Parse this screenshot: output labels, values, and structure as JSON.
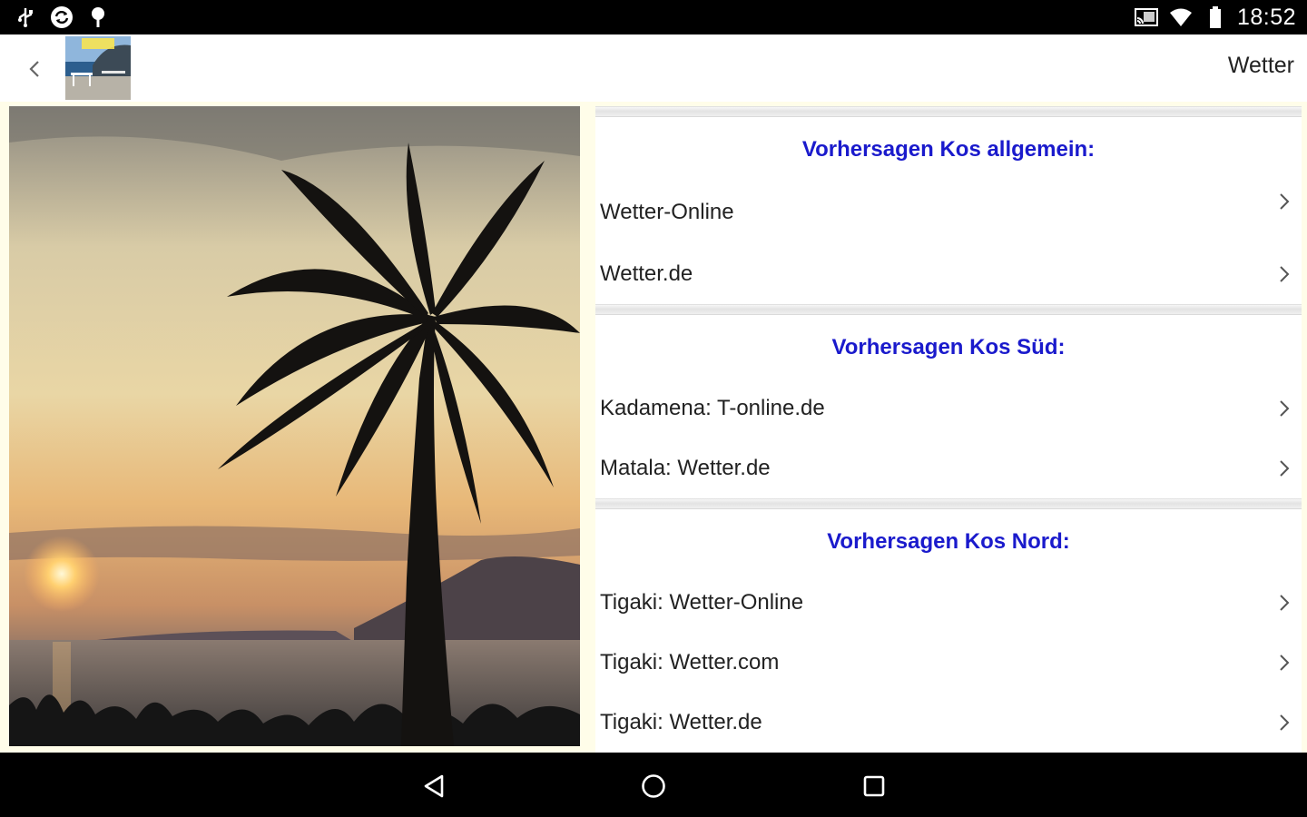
{
  "status_bar": {
    "time": "18:52",
    "icons": [
      "usb-icon",
      "sync-icon",
      "location-pin-icon",
      "cast-icon",
      "wifi-icon",
      "battery-icon"
    ]
  },
  "app_bar": {
    "title": "Wetter",
    "thumbnail_icon": "kos-beach-thumbnail"
  },
  "photo": {
    "subject": "palm-tree-sunset-photo"
  },
  "sections": [
    {
      "title": "Vorhersagen Kos allgemein:",
      "items": [
        "Wetter-Online",
        "Wetter.de"
      ]
    },
    {
      "title": "Vorhersagen Kos Süd:",
      "items": [
        "Kadamena: T-online.de",
        "Matala: Wetter.de"
      ]
    },
    {
      "title": "Vorhersagen Kos Nord:",
      "items": [
        "Tigaki: Wetter-Online",
        "Tigaki: Wetter.com",
        "Tigaki: Wetter.de"
      ]
    }
  ],
  "colors": {
    "section_title": "#1a1acc",
    "background": "#fffde9"
  },
  "nav_bar": {
    "icons": [
      "back-triangle-icon",
      "home-circle-icon",
      "recents-square-icon"
    ]
  }
}
